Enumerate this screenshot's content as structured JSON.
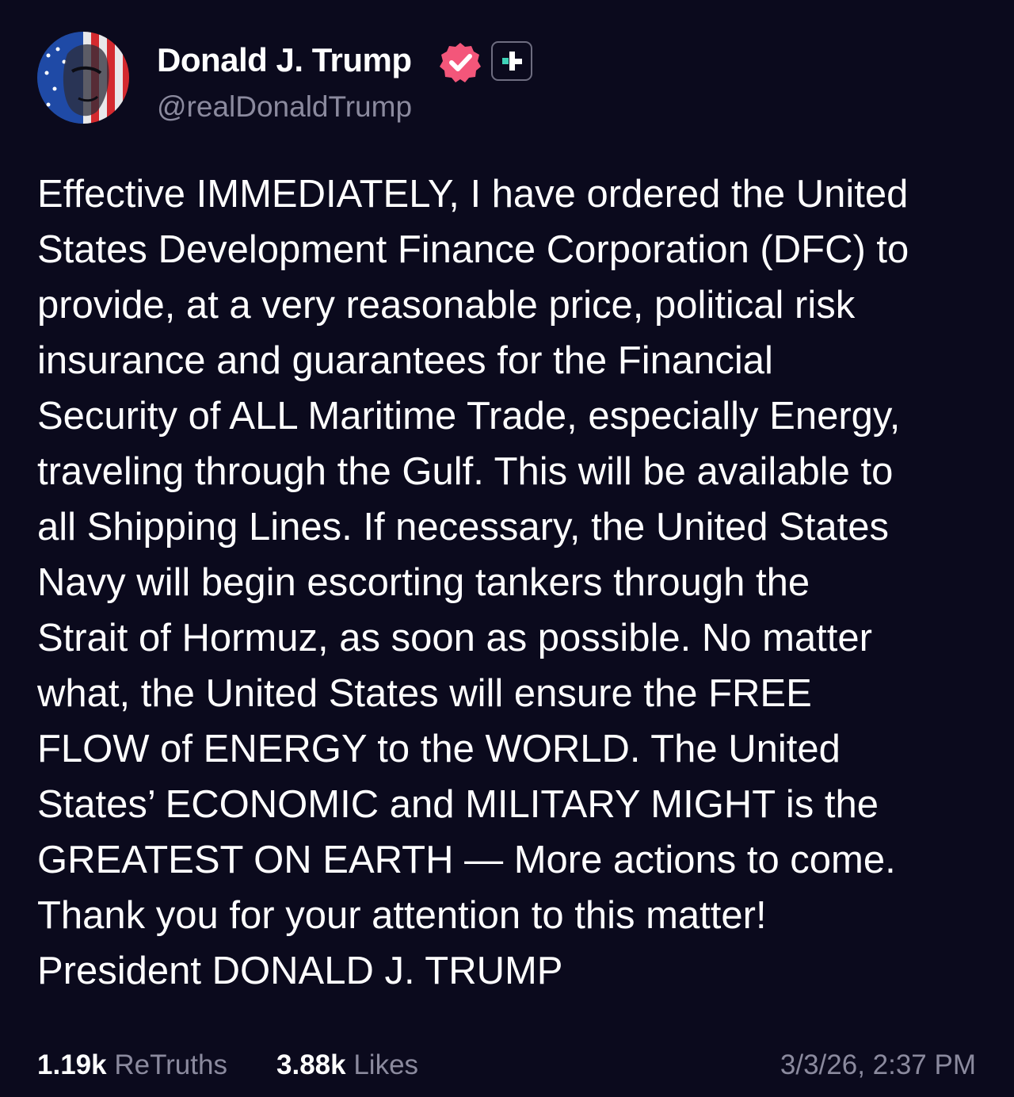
{
  "author": {
    "display_name": "Donald J. Trump",
    "handle": "@realDonaldTrump",
    "avatar_icon": "avatar-flag-portrait",
    "verified_icon": "verified-check-icon",
    "plus_icon": "plus-badge-icon"
  },
  "post": {
    "lines": [
      "Effective IMMEDIATELY, I have ordered the United",
      "States Development Finance Corporation (DFC) to",
      "provide, at a very reasonable price, political risk",
      "insurance and guarantees for the Financial",
      "Security of ALL Maritime Trade, especially Energy,",
      "traveling through the Gulf. This will be available to",
      "all Shipping Lines. If necessary, the United States",
      "Navy will begin escorting tankers through the",
      "Strait of Hormuz, as soon as possible. No matter",
      "what, the United States will ensure the FREE",
      "FLOW of ENERGY to the WORLD. The United",
      "States’ ECONOMIC and MILITARY MIGHT is the",
      "GREATEST ON EARTH — More actions to come.",
      "Thank you for your attention to this matter!",
      "President DONALD J. TRUMP"
    ]
  },
  "stats": {
    "retruths_count": "1.19k",
    "retruths_label": "ReTruths",
    "likes_count": "3.88k",
    "likes_label": "Likes",
    "timestamp": "3/3/26, 2:37 PM"
  },
  "colors": {
    "background": "#0b0a1d",
    "text": "#ffffff",
    "secondary_text": "#8b8a9e",
    "verified_badge": "#f3567a",
    "plus_accent": "#3fd3b8"
  }
}
